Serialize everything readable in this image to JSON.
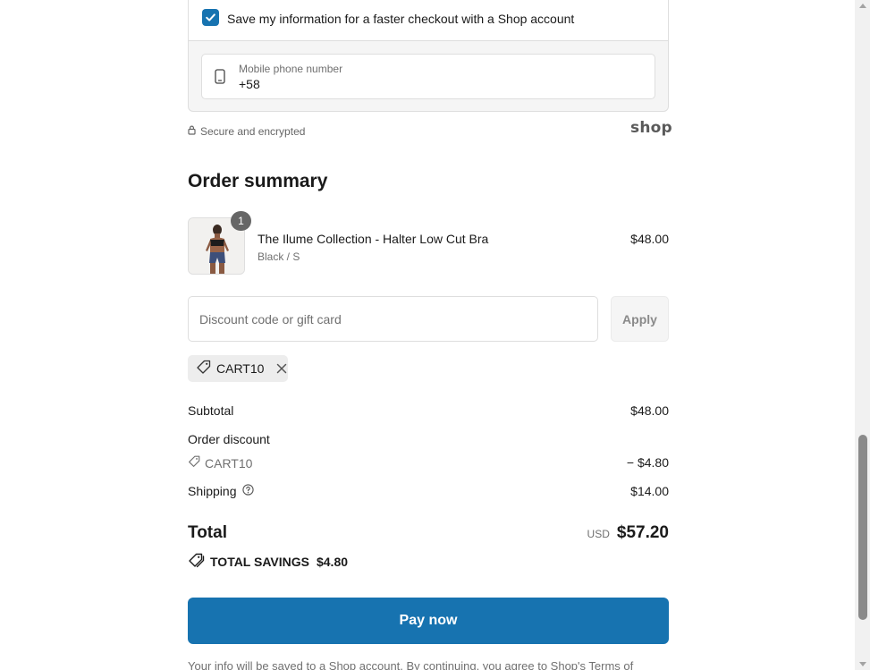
{
  "shop_save": {
    "checkbox_checked": true,
    "label": "Save my information for a faster checkout with a Shop account",
    "phone_label": "Mobile phone number",
    "phone_value": "+58"
  },
  "security": {
    "text": "Secure and encrypted",
    "brand": "shop"
  },
  "order_summary": {
    "title": "Order summary",
    "item": {
      "quantity": "1",
      "name": "The Ilume Collection - Halter Low Cut Bra",
      "variant": "Black / S",
      "price": "$48.00"
    },
    "discount": {
      "placeholder": "Discount code or gift card",
      "apply_label": "Apply",
      "applied_code": "CART10"
    },
    "rows": {
      "subtotal_label": "Subtotal",
      "subtotal_value": "$48.00",
      "order_discount_label": "Order discount",
      "order_discount_code": "CART10",
      "order_discount_value": "− $4.80",
      "shipping_label": "Shipping",
      "shipping_value": "$14.00"
    },
    "total": {
      "label": "Total",
      "currency": "USD",
      "amount": "$57.20"
    },
    "savings": {
      "label": "TOTAL SAVINGS",
      "amount": "$4.80"
    }
  },
  "pay_button": "Pay now",
  "footnote": "Your info will be saved to a Shop account. By continuing, you agree to Shop's Terms of",
  "colors": {
    "accent": "#1773b0",
    "text": "#1a1a1a",
    "muted": "#707070",
    "border": "#dedede"
  }
}
